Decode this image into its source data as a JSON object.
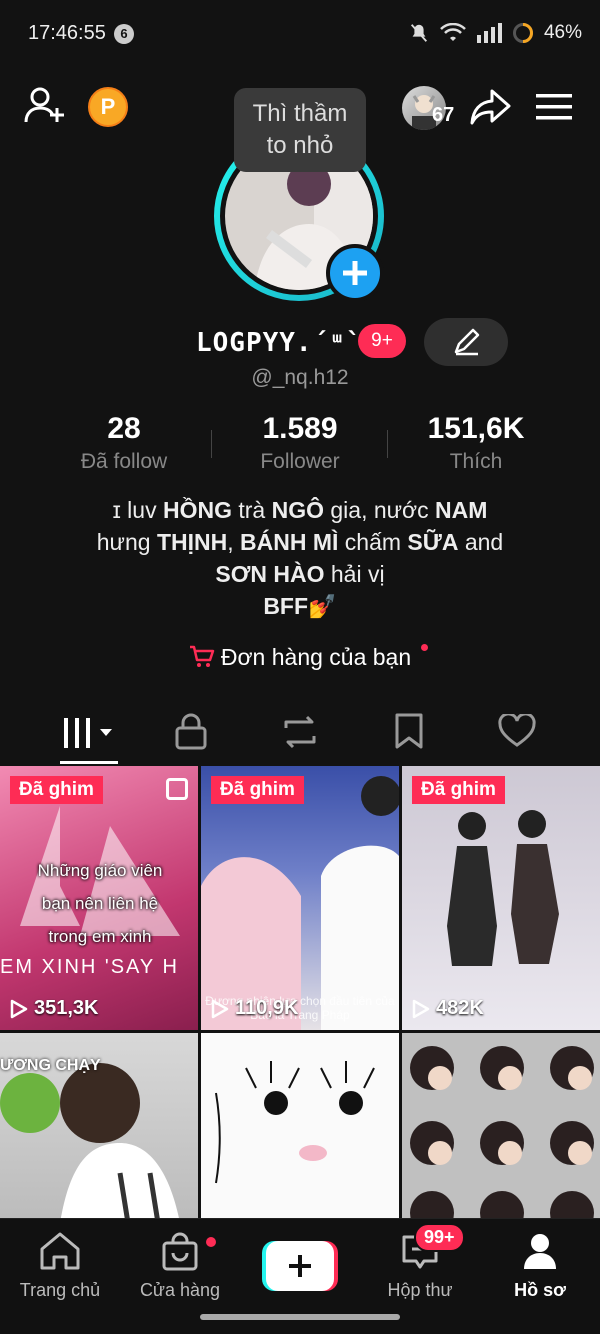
{
  "status": {
    "time": "17:46:55",
    "notif_count": "6",
    "battery": "46%"
  },
  "topbar": {
    "coin_label": "P",
    "friends_count": "67"
  },
  "tooltip": {
    "line1": "Thì thầm",
    "line2": "to nhỏ"
  },
  "profile": {
    "display_name": "LOGPYY.´ᵚ`",
    "badge": "9+",
    "handle": "@_nq.h12",
    "stats": [
      {
        "value": "28",
        "label": "Đã follow"
      },
      {
        "value": "1.589",
        "label": "Follower"
      },
      {
        "value": "151,6K",
        "label": "Thích"
      }
    ],
    "bio": {
      "line1_a": "ɪ luv ",
      "line1_b": "HỒNG",
      "line1_c": " trà ",
      "line1_d": "NGÔ",
      "line1_e": " gia, nước ",
      "line1_f": "NAM",
      "line2_a": "hưng ",
      "line2_b": "THỊNH",
      "line2_c": ", ",
      "line2_d": "BÁNH MÌ",
      "line2_e": " chấm ",
      "line2_f": "SỮA",
      "line2_g": " and",
      "line3_a": "SƠN HÀO",
      "line3_b": " hải vị",
      "line4": "BFF💅"
    },
    "orders_label": "Đơn hàng của bạn"
  },
  "videos": [
    {
      "pinned": "Đã ghim",
      "views": "351,3K",
      "caption": "Những giáo viên bạn nên liên hệ trong em xinh",
      "banner": "EM XINH 'SAY H"
    },
    {
      "pinned": "Đã ghim",
      "views": "110,9K",
      "caption": "Đương nhiên lựa chọn đầu tiên của Bảo là Trang Pháp"
    },
    {
      "pinned": "Đã ghim",
      "views": "482K"
    },
    {
      "banner": "ƯƠNG CHẠY"
    },
    {},
    {}
  ],
  "nav": {
    "home": "Trang chủ",
    "shop": "Cửa hàng",
    "inbox": "Hộp thư",
    "inbox_badge": "99+",
    "profile": "Hồ sơ"
  },
  "colors": {
    "accent": "#fe2c55",
    "teal": "#25f4ee",
    "background": "#121212"
  }
}
